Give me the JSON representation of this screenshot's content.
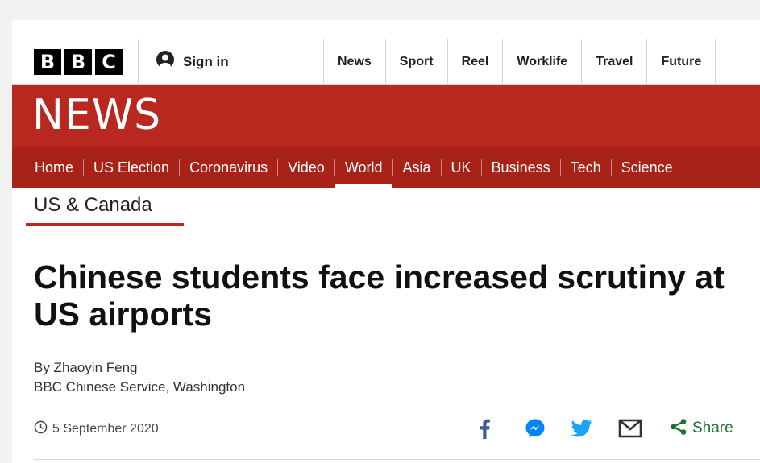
{
  "header": {
    "logo_letters": [
      "B",
      "B",
      "C"
    ],
    "sign_in_label": "Sign in",
    "top_nav": [
      "News",
      "Sport",
      "Reel",
      "Worklife",
      "Travel",
      "Future"
    ]
  },
  "news_band": {
    "wordmark": "NEWS"
  },
  "sub_nav": {
    "items": [
      "Home",
      "US Election",
      "Coronavirus",
      "Video",
      "World",
      "Asia",
      "UK",
      "Business",
      "Tech",
      "Science"
    ],
    "active": "World"
  },
  "article": {
    "section": "US & Canada",
    "headline": "Chinese students face increased scrutiny at US airports",
    "author": "By Zhaoyin Feng",
    "affiliation": "BBC Chinese Service, Washington",
    "date": "5 September 2020",
    "share_label": "Share"
  },
  "colors": {
    "brand_red": "#b8281e",
    "nav_red": "#a92218",
    "facebook_blue": "#3b5998",
    "messenger_blue": "#0084ff",
    "twitter_blue": "#1da1f2",
    "share_green": "#1f6f30"
  },
  "icons": [
    "user-icon",
    "clock-icon",
    "facebook-icon",
    "messenger-icon",
    "twitter-icon",
    "email-icon",
    "share-icon"
  ]
}
